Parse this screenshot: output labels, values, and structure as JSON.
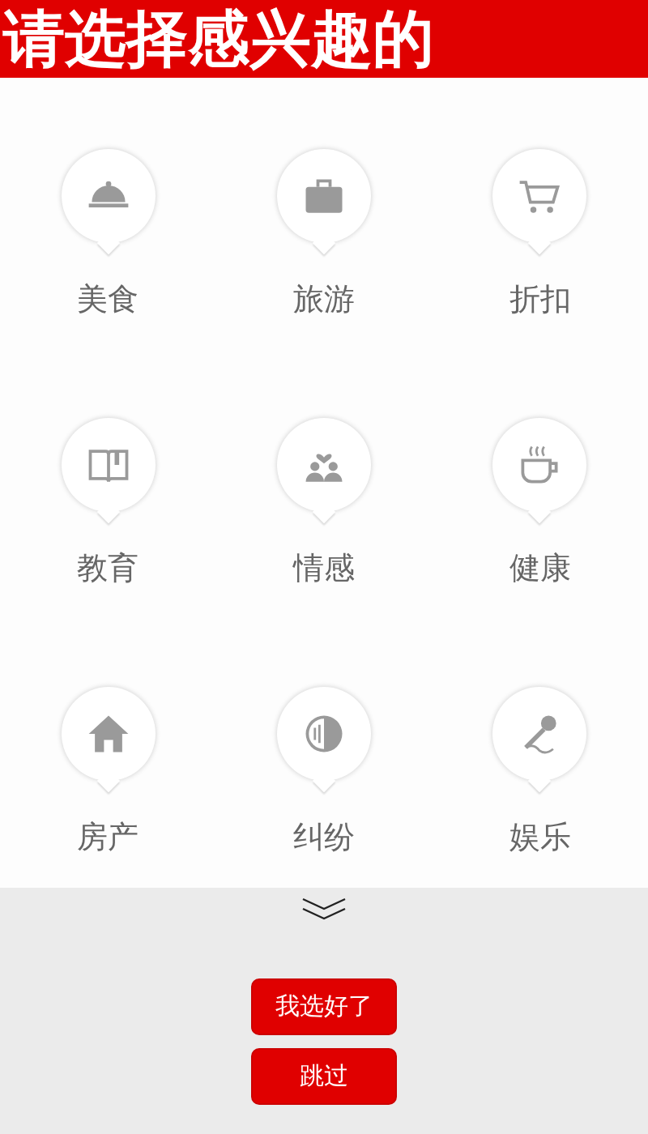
{
  "header": {
    "title": "请选择感兴趣的"
  },
  "categories": [
    {
      "label": "美食"
    },
    {
      "label": "旅游"
    },
    {
      "label": "折扣"
    },
    {
      "label": "教育"
    },
    {
      "label": "情感"
    },
    {
      "label": "健康"
    },
    {
      "label": "房产"
    },
    {
      "label": "纠纷"
    },
    {
      "label": "娱乐"
    }
  ],
  "buttons": [
    {
      "label": "我选好了"
    },
    {
      "label": "跳过"
    }
  ]
}
